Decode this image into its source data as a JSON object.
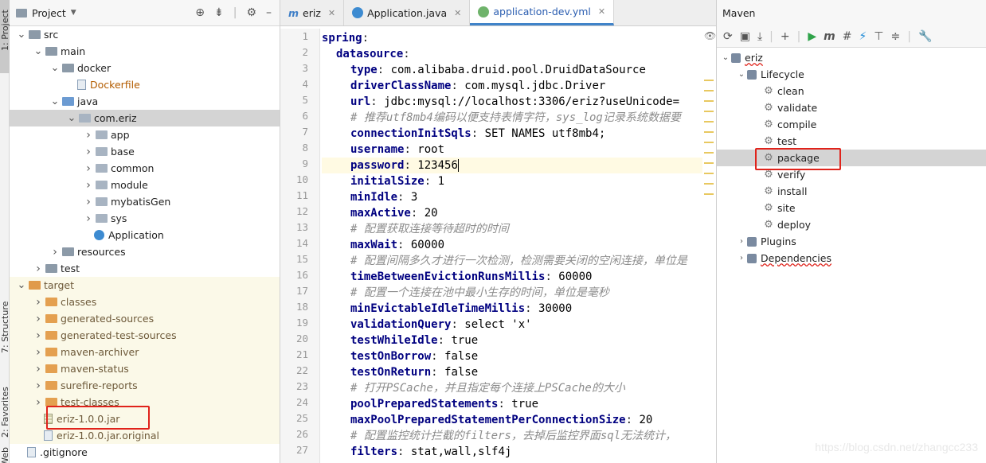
{
  "left_strip": {
    "tabs": [
      {
        "label": "1: Project",
        "selected": true
      },
      {
        "label": "7: Structure",
        "selected": false
      },
      {
        "label": "2: Favorites",
        "selected": false
      },
      {
        "label": "Web",
        "selected": false
      }
    ]
  },
  "project": {
    "title": "Project",
    "tree": [
      {
        "label": "src",
        "depth": 1,
        "icon": "folder"
      },
      {
        "label": "main",
        "depth": 2,
        "icon": "folder"
      },
      {
        "label": "docker",
        "depth": 3,
        "icon": "folder"
      },
      {
        "label": "Dockerfile",
        "depth": 4,
        "icon": "file"
      },
      {
        "label": "java",
        "depth": 3,
        "icon": "folder-blue"
      },
      {
        "label": "com.eriz",
        "depth": 4,
        "icon": "package"
      },
      {
        "label": "app",
        "depth": 5,
        "icon": "package"
      },
      {
        "label": "base",
        "depth": 5,
        "icon": "package"
      },
      {
        "label": "common",
        "depth": 5,
        "icon": "package"
      },
      {
        "label": "module",
        "depth": 5,
        "icon": "package"
      },
      {
        "label": "mybatisGen",
        "depth": 5,
        "icon": "package"
      },
      {
        "label": "sys",
        "depth": 5,
        "icon": "package"
      },
      {
        "label": "Application",
        "depth": 5,
        "icon": "class"
      },
      {
        "label": "resources",
        "depth": 3,
        "icon": "folder-res"
      },
      {
        "label": "test",
        "depth": 2,
        "icon": "folder"
      },
      {
        "label": "target",
        "depth": 1,
        "icon": "folder-target"
      },
      {
        "label": "classes",
        "depth": 2,
        "icon": "folder-orange"
      },
      {
        "label": "generated-sources",
        "depth": 2,
        "icon": "folder-orange"
      },
      {
        "label": "generated-test-sources",
        "depth": 2,
        "icon": "folder-orange"
      },
      {
        "label": "maven-archiver",
        "depth": 2,
        "icon": "folder-orange"
      },
      {
        "label": "maven-status",
        "depth": 2,
        "icon": "folder-orange"
      },
      {
        "label": "surefire-reports",
        "depth": 2,
        "icon": "folder-orange"
      },
      {
        "label": "test-classes",
        "depth": 2,
        "icon": "folder-orange"
      },
      {
        "label": "eriz-1.0.0.jar",
        "depth": 2,
        "icon": "jar"
      },
      {
        "label": "eriz-1.0.0.jar.original",
        "depth": 2,
        "icon": "file"
      },
      {
        "label": ".gitignore",
        "depth": 1,
        "icon": "file"
      }
    ]
  },
  "editor": {
    "tabs": [
      {
        "label": "eriz",
        "active": false
      },
      {
        "label": "Application.java",
        "active": false
      },
      {
        "label": "application-dev.yml",
        "active": true
      }
    ],
    "lines": [
      {
        "n": "1",
        "key": "spring",
        "sep": ":",
        "val": "",
        "indent": 0
      },
      {
        "n": "2",
        "key": "datasource",
        "sep": ":",
        "val": "",
        "indent": 1
      },
      {
        "n": "3",
        "key": "type",
        "sep": ":",
        "val": " com.alibaba.druid.pool.DruidDataSource",
        "indent": 2
      },
      {
        "n": "4",
        "key": "driverClassName",
        "sep": ":",
        "val": " com.mysql.jdbc.Driver",
        "indent": 2
      },
      {
        "n": "5",
        "key": "url",
        "sep": ":",
        "val": " jdbc:mysql://localhost:3306/eriz?useUnicode=",
        "indent": 2
      },
      {
        "n": "6",
        "comment": "# 推荐utf8mb4编码以便支持表情字符，sys_log记录系统数据要",
        "indent": 2
      },
      {
        "n": "7",
        "key": "connectionInitSqls",
        "sep": ":",
        "val": " SET NAMES utf8mb4;",
        "indent": 2
      },
      {
        "n": "8",
        "key": "username",
        "sep": ":",
        "val": " root",
        "indent": 2
      },
      {
        "n": "9",
        "key": "password",
        "sep": ":",
        "val": " 123456",
        "indent": 2
      },
      {
        "n": "10",
        "key": "initialSize",
        "sep": ":",
        "val": " 1",
        "indent": 2
      },
      {
        "n": "11",
        "key": "minIdle",
        "sep": ":",
        "val": " 3",
        "indent": 2
      },
      {
        "n": "12",
        "key": "maxActive",
        "sep": ":",
        "val": " 20",
        "indent": 2
      },
      {
        "n": "13",
        "comment": "# 配置获取连接等待超时的时间",
        "indent": 2
      },
      {
        "n": "14",
        "key": "maxWait",
        "sep": ":",
        "val": " 60000",
        "indent": 2
      },
      {
        "n": "15",
        "comment": "# 配置间隔多久才进行一次检测，检测需要关闭的空闲连接，单位是",
        "indent": 2
      },
      {
        "n": "16",
        "key": "timeBetweenEvictionRunsMillis",
        "sep": ":",
        "val": " 60000",
        "indent": 2
      },
      {
        "n": "17",
        "comment": "# 配置一个连接在池中最小生存的时间，单位是毫秒",
        "indent": 2
      },
      {
        "n": "18",
        "key": "minEvictableIdleTimeMillis",
        "sep": ":",
        "val": " 30000",
        "indent": 2
      },
      {
        "n": "19",
        "key": "validationQuery",
        "sep": ":",
        "val": " select 'x'",
        "indent": 2
      },
      {
        "n": "20",
        "key": "testWhileIdle",
        "sep": ":",
        "val": " true",
        "indent": 2
      },
      {
        "n": "21",
        "key": "testOnBorrow",
        "sep": ":",
        "val": " false",
        "indent": 2
      },
      {
        "n": "22",
        "key": "testOnReturn",
        "sep": ":",
        "val": " false",
        "indent": 2
      },
      {
        "n": "23",
        "comment": "# 打开PSCache，并且指定每个连接上PSCache的大小",
        "indent": 2
      },
      {
        "n": "24",
        "key": "poolPreparedStatements",
        "sep": ":",
        "val": " true",
        "indent": 2
      },
      {
        "n": "25",
        "key": "maxPoolPreparedStatementPerConnectionSize",
        "sep": ":",
        "val": " 20",
        "indent": 2
      },
      {
        "n": "26",
        "comment": "# 配置监控统计拦截的filters，去掉后监控界面sql无法统计，",
        "indent": 2
      },
      {
        "n": "27",
        "key": "filters",
        "sep": ":",
        "val": " stat,wall,slf4j",
        "indent": 2
      }
    ]
  },
  "maven": {
    "title": "Maven",
    "project": "eriz",
    "lifecycle_label": "Lifecycle",
    "phases": [
      "clean",
      "validate",
      "compile",
      "test",
      "package",
      "verify",
      "install",
      "site",
      "deploy"
    ],
    "plugins_label": "Plugins",
    "dependencies_label": "Dependencies"
  },
  "watermark": "https://blog.csdn.net/zhangcc233"
}
